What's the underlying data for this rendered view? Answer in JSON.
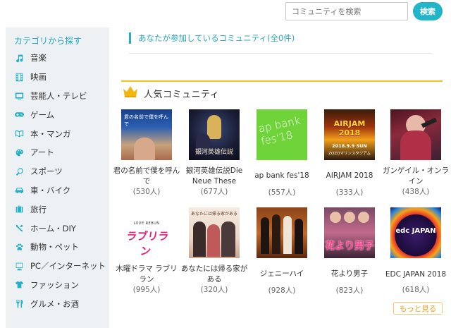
{
  "search": {
    "placeholder": "コミュニティを検索",
    "button_label": "検索"
  },
  "sidebar": {
    "title": "カテゴリから探す",
    "items": [
      {
        "label": "音楽",
        "icon": "music-note-icon"
      },
      {
        "label": "映画",
        "icon": "film-icon"
      },
      {
        "label": "芸能人・テレビ",
        "icon": "tv-icon"
      },
      {
        "label": "ゲーム",
        "icon": "gamepad-icon"
      },
      {
        "label": "本・マンガ",
        "icon": "book-icon"
      },
      {
        "label": "アート",
        "icon": "palette-icon"
      },
      {
        "label": "スポーツ",
        "icon": "racket-icon"
      },
      {
        "label": "車・バイク",
        "icon": "car-icon"
      },
      {
        "label": "旅行",
        "icon": "suitcase-icon"
      },
      {
        "label": "ホーム・DIY",
        "icon": "tools-icon"
      },
      {
        "label": "動物・ペット",
        "icon": "paw-icon"
      },
      {
        "label": "PC／インターネット",
        "icon": "computer-icon"
      },
      {
        "label": "ファッション",
        "icon": "shirt-icon"
      },
      {
        "label": "グルメ・お酒",
        "icon": "fork-knife-icon"
      }
    ]
  },
  "joined": {
    "label": "あなたが参加しているコミュニティ(全0件)"
  },
  "popular": {
    "title": "人気コミュニティ",
    "communities": [
      {
        "name": "君の名前で僕を呼んで",
        "count": "(530人)"
      },
      {
        "name": "銀河英雄伝説Die Neue These",
        "count": "(677人)"
      },
      {
        "name": "ap bank fes'18",
        "count": "(557人)"
      },
      {
        "name": "AIRJAM 2018",
        "count": "(333人)"
      },
      {
        "name": "ガンゲイル・オンライン",
        "count": "(438人)"
      },
      {
        "name": "木曜ドラマ ラブリラン",
        "count": "(995人)"
      },
      {
        "name": "あなたには帰る家がある",
        "count": "(320人)"
      },
      {
        "name": "ジェニーハイ",
        "count": "(928人)"
      },
      {
        "name": "花より男子",
        "count": "(823人)"
      },
      {
        "name": "EDC JAPAN 2018",
        "count": "(618人)"
      }
    ],
    "thumb_text": {
      "t1": "君の名前で僕を呼んで",
      "t2": "銀河英雄伝説",
      "t3": "ap bank fes'18",
      "t4": "AIRJAM 2018",
      "t4_date": "2018.9.9 SUN",
      "t4_venue": "ZOZOマリンスタジアム",
      "t6_top": "LOVE REBUN",
      "t6": "ラブリラン",
      "t7": "あなたには帰る家がある",
      "t9": "花より男子",
      "t10": "edc JAPAN"
    }
  },
  "more": {
    "label": "もっと見る"
  },
  "colors": {
    "accent": "#22b4c9",
    "gold": "#f3c21b",
    "sidebar_bg": "#eef1f4"
  }
}
